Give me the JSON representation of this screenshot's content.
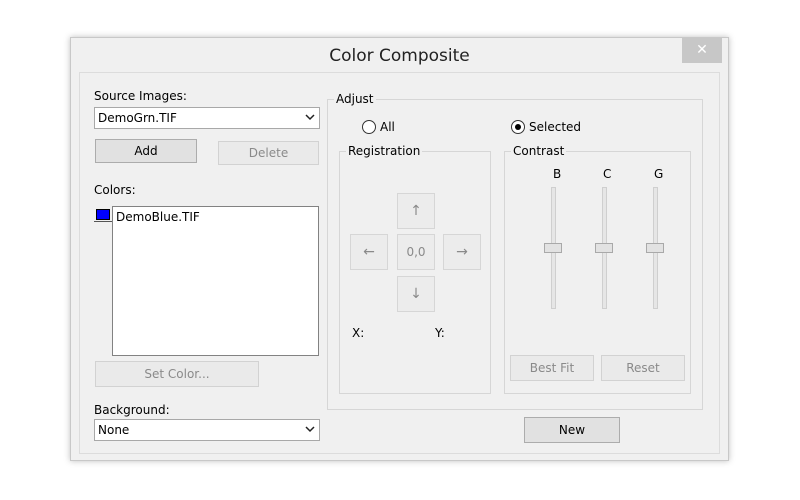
{
  "window": {
    "title": "Color Composite",
    "close_glyph": "✕"
  },
  "source": {
    "label": "Source Images:",
    "selected": "DemoGrn.TIF",
    "add_label": "Add",
    "delete_label": "Delete"
  },
  "colors": {
    "label": "Colors:",
    "items": [
      {
        "name": "DemoBlue.TIF",
        "color": "#0000ff"
      }
    ],
    "set_color_label": "Set Color..."
  },
  "background": {
    "label": "Background:",
    "selected": "None"
  },
  "adjust": {
    "title": "Adjust",
    "radio_all": {
      "label": "All",
      "checked": false
    },
    "radio_selected": {
      "label": "Selected",
      "checked": true
    },
    "registration": {
      "title": "Registration",
      "up_glyph": "↑",
      "down_glyph": "↓",
      "left_glyph": "←",
      "right_glyph": "→",
      "center_value": "0,0",
      "x_label": "X:",
      "y_label": "Y:"
    },
    "contrast": {
      "title": "Contrast",
      "sliders": [
        {
          "label": "B",
          "level": 0.5
        },
        {
          "label": "C",
          "level": 0.5
        },
        {
          "label": "G",
          "level": 0.5
        }
      ],
      "best_fit_label": "Best Fit",
      "reset_label": "Reset"
    }
  },
  "new_label": "New"
}
